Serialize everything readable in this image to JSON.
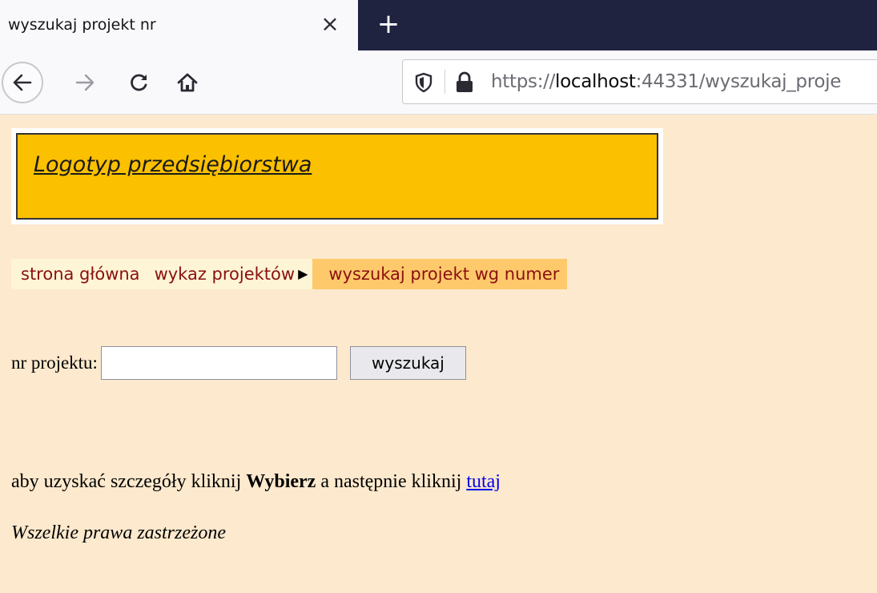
{
  "browser": {
    "tab_title": "wyszukaj projekt nr",
    "tab_close": "×",
    "new_tab": "+",
    "url_prefix": "https://",
    "url_host": "localhost",
    "url_rest": ":44331/wyszukaj_proje",
    "icons": [
      "back-arrow-icon",
      "forward-arrow-icon",
      "reload-icon",
      "home-icon",
      "shield-icon",
      "lock-icon"
    ]
  },
  "page": {
    "logo_text": "Logotyp przedsiębiorstwa",
    "breadcrumb": {
      "home": "strona główna",
      "projects": "wykaz projektów",
      "current": "wyszukaj projekt wg numer"
    },
    "search": {
      "label": "nr projektu:",
      "value": "",
      "button": "wyszukaj"
    },
    "info": {
      "before": "aby uzyskać szczegóły kliknij ",
      "bold": "Wybierz",
      "middle": " a następnie kliknij ",
      "link": "tutaj"
    },
    "footer": "Wszelkie prawa zastrzeżone"
  },
  "colors": {
    "page_bg": "#fde9cd",
    "logo_bg": "#fbc000",
    "breadcrumb_bg": "#fdf5d5",
    "breadcrumb_current_bg": "#fec96b",
    "breadcrumb_text": "#8b1010",
    "tabstrip_bg": "#202340"
  }
}
